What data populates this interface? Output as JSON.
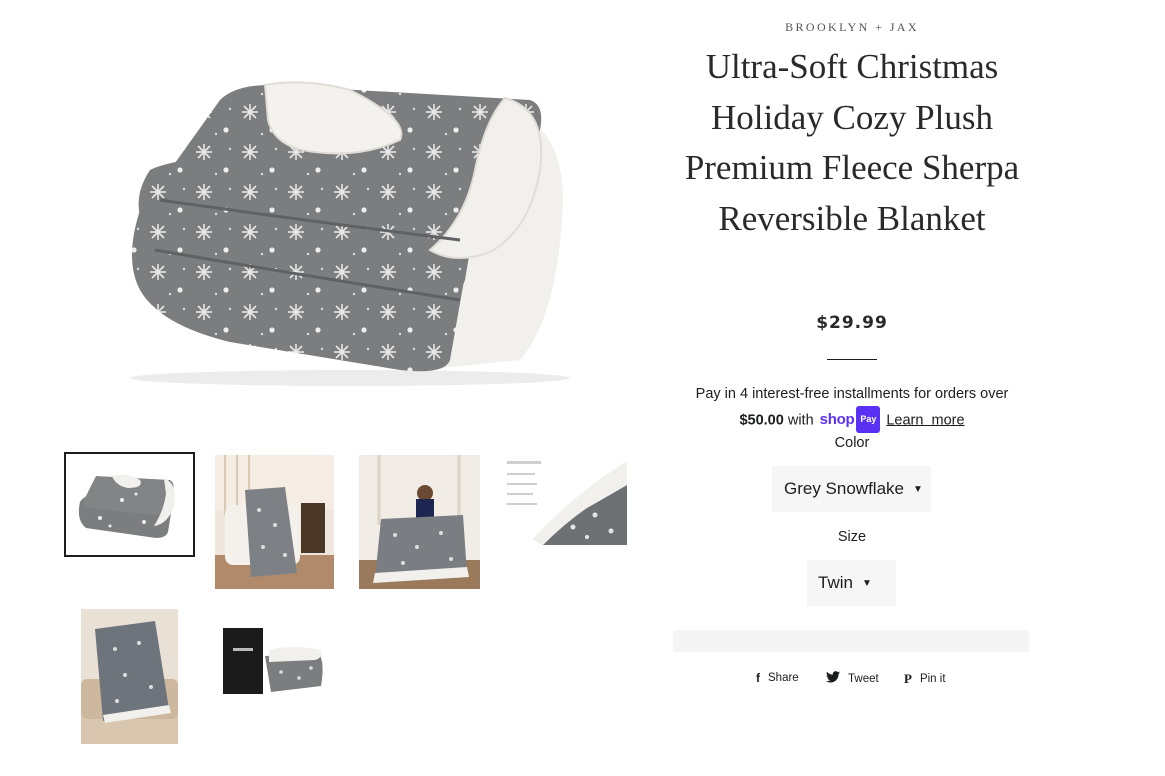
{
  "product": {
    "vendor": "BROOKLYN + JAX",
    "title": "Ultra-Soft Christmas Holiday Cozy Plush Premium Fleece Sherpa Reversible Blanket",
    "price": "$29.99"
  },
  "installments": {
    "prefix": "Pay in 4 interest-free installments for orders over",
    "amount": "$50.00",
    "with": "with",
    "brand_shop": "shop",
    "brand_pay": "Pay",
    "learn_more": "Learn  more"
  },
  "options": {
    "color_label": "Color",
    "color_value": "Grey Snowflake",
    "size_label": "Size",
    "size_value": "Twin"
  },
  "social": {
    "share": "Share",
    "tweet": "Tweet",
    "pin": "Pin it"
  },
  "gallery": {
    "selected_index": 0,
    "thumbnail_count": 6
  },
  "colors": {
    "text": "#1c1d1d",
    "blanket_grey": "#7b7d7f",
    "sherpa": "#f2f0ec",
    "shop_pay": "#5a31f4",
    "select_bg": "#f6f6f6"
  }
}
